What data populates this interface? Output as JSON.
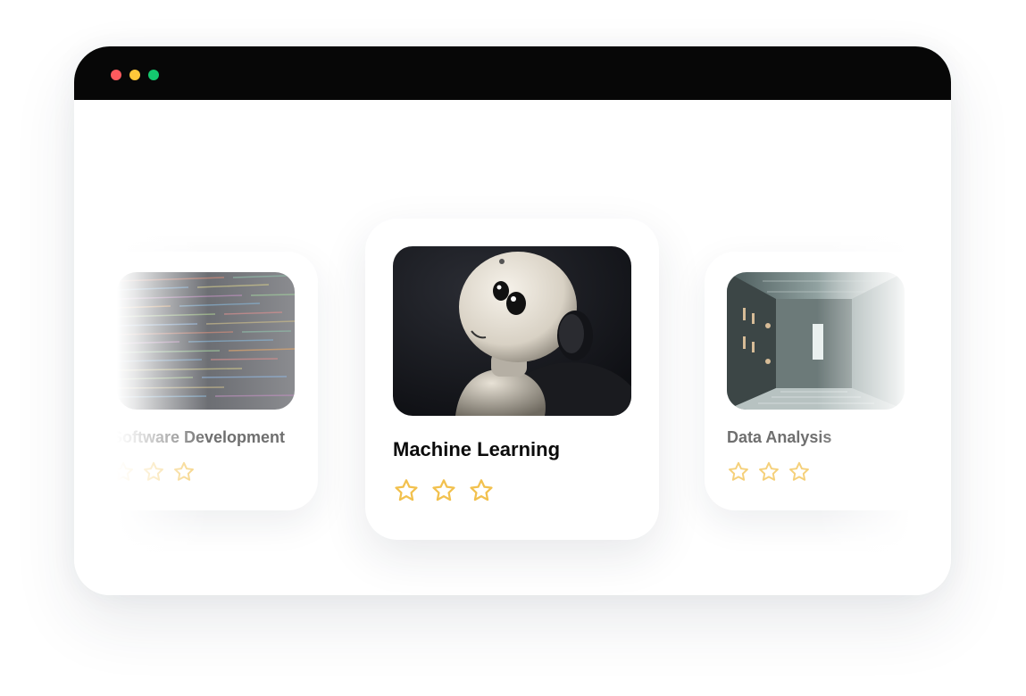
{
  "window": {
    "controls": [
      "close",
      "minimize",
      "maximize"
    ],
    "colors": {
      "close": "#fe5a5e",
      "minimize": "#fec73a",
      "maximize": "#14c86e",
      "titlebar": "#070707"
    }
  },
  "carousel": {
    "active_index": 1,
    "cards": [
      {
        "title": "Software Development",
        "image": "code-screen-image",
        "rating": 0,
        "max_rating": 3
      },
      {
        "title": "Machine Learning",
        "image": "robot-image",
        "rating": 0,
        "max_rating": 3
      },
      {
        "title": "Data Analysis",
        "image": "server-room-image",
        "rating": 0,
        "max_rating": 3
      }
    ],
    "star_color": "#f2c14e"
  }
}
